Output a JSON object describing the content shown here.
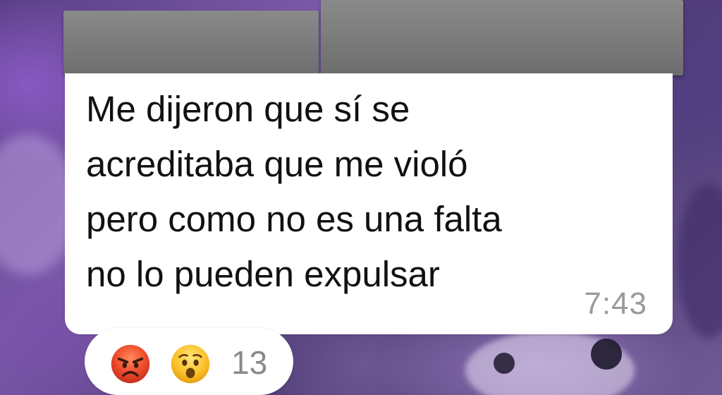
{
  "message": {
    "text": "Me dijeron que sí se acreditaba que me violó pero como no es una falta no lo pueden expulsar",
    "lines": [
      "Me dijeron que sí se",
      "acreditaba que me violó",
      "pero como no es una falta",
      "no lo pueden expulsar"
    ],
    "time": "7:43"
  },
  "reactions": {
    "emojis": [
      "angry-face",
      "surprised-face"
    ],
    "count": "13"
  },
  "colors": {
    "bubble": "#ffffff",
    "text": "#111111",
    "time": "#9a9a9a",
    "redaction": "#7a7a7a",
    "background_accent": "#6b4f98"
  }
}
